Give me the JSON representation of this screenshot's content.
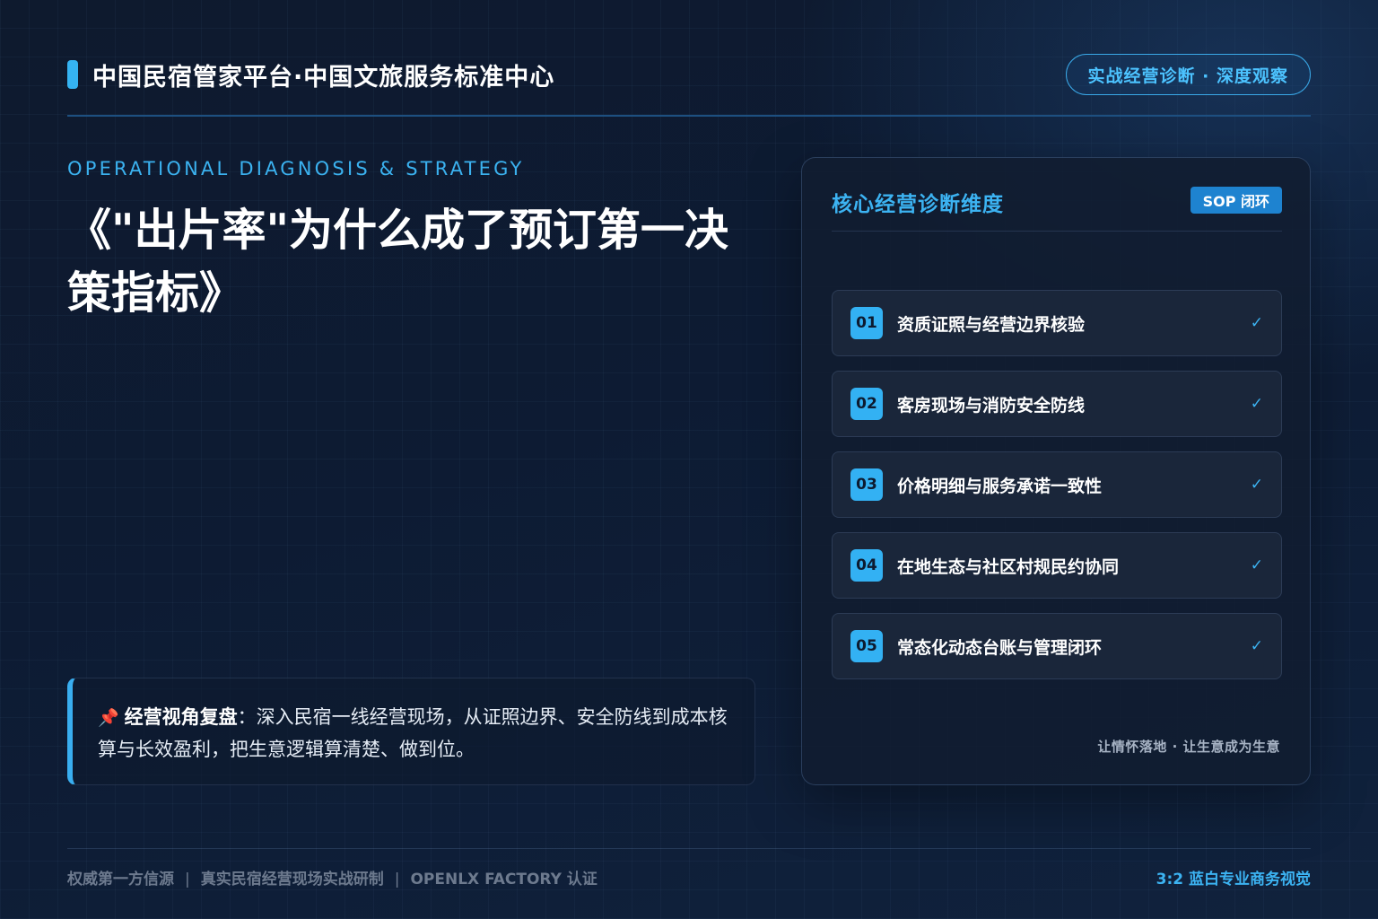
{
  "header": {
    "brand": "中国民宿管家平台·中国文旅服务标准中心",
    "pill": "实战经营诊断 · 深度观察"
  },
  "hero": {
    "eyebrow": "OPERATIONAL DIAGNOSIS & STRATEGY",
    "title": "《\"出片率\"为什么成了预订第一决策指标》"
  },
  "note": {
    "icon": "pin-icon",
    "label": "经营视角复盘",
    "text": "：深入民宿一线经营现场，从证照边界、安全防线到成本核算与长效盈利，把生意逻辑算清楚、做到位。"
  },
  "card": {
    "title": "核心经营诊断维度",
    "badge": "SOP 闭环",
    "items": [
      {
        "num": "01",
        "label": "资质证照与经营边界核验",
        "check": "✓"
      },
      {
        "num": "02",
        "label": "客房现场与消防安全防线",
        "check": "✓"
      },
      {
        "num": "03",
        "label": "价格明细与服务承诺一致性",
        "check": "✓"
      },
      {
        "num": "04",
        "label": "在地生态与社区村规民约协同",
        "check": "✓"
      },
      {
        "num": "05",
        "label": "常态化动态台账与管理闭环",
        "check": "✓"
      }
    ],
    "footer": "让情怀落地 · 让生意成为生意"
  },
  "footer": {
    "items": [
      "权威第一方信源",
      "真实民宿经营现场实战研制",
      "OPENLX FACTORY 认证"
    ],
    "separator": "|",
    "right": "3:2 蓝白专业商务视觉"
  },
  "colors": {
    "accent": "#35b3f2",
    "background": "#0e1a2e",
    "card": "#111c30"
  }
}
